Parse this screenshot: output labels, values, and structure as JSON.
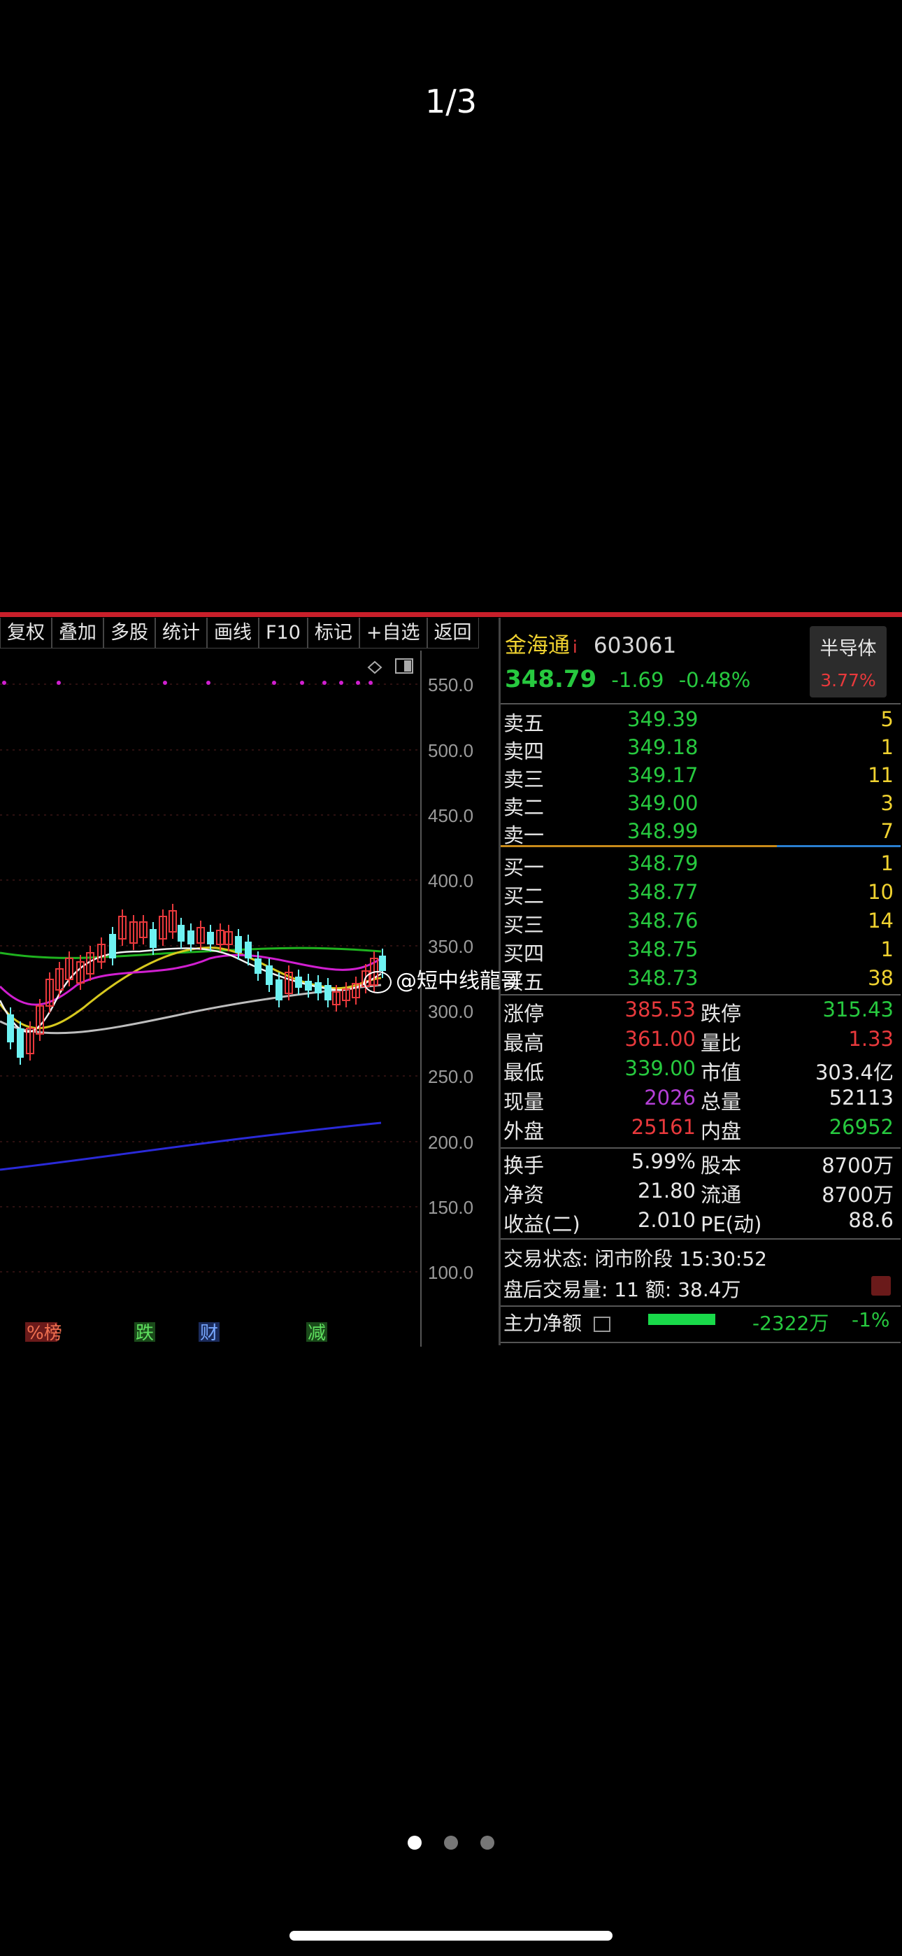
{
  "page_counter": "1/3",
  "toolbar": {
    "items": [
      "复权",
      "叠加",
      "多股",
      "统计",
      "画线",
      "F10",
      "标记",
      "+自选",
      "返回"
    ]
  },
  "chart": {
    "y_ticks": [
      "550.0",
      "500.0",
      "450.0",
      "400.0",
      "350.0",
      "300.0",
      "250.0",
      "200.0",
      "150.0",
      "100.0"
    ],
    "markers": [
      "%榜",
      "跌",
      "财",
      "减"
    ]
  },
  "quote": {
    "name": "金海通",
    "name_suffix": "i",
    "code": "603061",
    "price": "348.79",
    "change": "-1.69",
    "change_pct": "-0.48%",
    "sector": "半导体",
    "sector_pct": "3.77%"
  },
  "asks": [
    {
      "label": "卖五",
      "price": "349.39",
      "vol": "5"
    },
    {
      "label": "卖四",
      "price": "349.18",
      "vol": "1"
    },
    {
      "label": "卖三",
      "price": "349.17",
      "vol": "11"
    },
    {
      "label": "卖二",
      "price": "349.00",
      "vol": "3"
    },
    {
      "label": "卖一",
      "price": "348.99",
      "vol": "7"
    }
  ],
  "bids": [
    {
      "label": "买一",
      "price": "348.79",
      "vol": "1"
    },
    {
      "label": "买二",
      "price": "348.77",
      "vol": "10"
    },
    {
      "label": "买三",
      "price": "348.76",
      "vol": "14"
    },
    {
      "label": "买四",
      "price": "348.75",
      "vol": "1"
    },
    {
      "label": "买五",
      "price": "348.73",
      "vol": "38"
    }
  ],
  "stats": [
    {
      "l1": "涨停",
      "v1": "385.53",
      "l2": "跌停",
      "v2": "315.43"
    },
    {
      "l1": "最高",
      "v1": "361.00",
      "l2": "量比",
      "v2": "1.33"
    },
    {
      "l1": "最低",
      "v1": "339.00",
      "l2": "市值",
      "v2": "303.4亿"
    },
    {
      "l1": "现量",
      "v1": "2026",
      "l2": "总量",
      "v2": "52113"
    },
    {
      "l1": "外盘",
      "v1": "25161",
      "l2": "内盘",
      "v2": "26952"
    }
  ],
  "stats2": [
    {
      "l1": "换手",
      "v1": "5.99%",
      "l2": "股本",
      "v2": "8700万"
    },
    {
      "l1": "净资",
      "v1": "21.80",
      "l2": "流通",
      "v2": "8700万"
    },
    {
      "l1": "收益(二)",
      "v1": "2.010",
      "l2": "PE(动)",
      "v2": "88.6"
    }
  ],
  "status": {
    "trade_state": "交易状态: 闭市阶段 15:30:52",
    "after_hours": "盘后交易量: 11  额: 38.4万",
    "main_label": "主力净额",
    "main_value": "-2322万",
    "main_pct": "-1%"
  },
  "watermark": "@短中线龍哥",
  "colors": {
    "up": "#e8393c",
    "down": "#27c93f",
    "accent": "#f0d230",
    "ma_purple": "#d01fd0",
    "topbar": "#c91f2a"
  }
}
